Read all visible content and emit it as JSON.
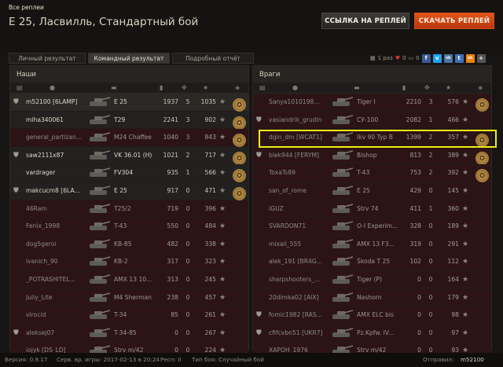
{
  "header": {
    "breadcrumb": "Все реплеи",
    "title": "E 25, Ласвилль, Стандартный бой",
    "link_button": "ССЫЛКА НА РЕПЛЕЙ",
    "download_button": "СКАЧАТЬ РЕПЛЕЙ"
  },
  "tabs": [
    "Личный результат",
    "Командный результат",
    "Подробный отчёт"
  ],
  "toolbar": {
    "views": "1 раз",
    "likes": "0",
    "comments": "0",
    "social": [
      "f",
      "v",
      "vk",
      "t",
      "ok",
      "+"
    ]
  },
  "allies": {
    "title": "Наши",
    "players": [
      {
        "name": "m52100 [6LAMP]",
        "tank": "E 25",
        "damage": "1937",
        "kills": "5",
        "xp": "1035",
        "state": "me",
        "clan": true,
        "medal": true
      },
      {
        "name": "miha340061",
        "tank": "T29",
        "damage": "2241",
        "kills": "3",
        "xp": "902",
        "state": "alive",
        "clan": false,
        "medal": true
      },
      {
        "name": "general_partizan...",
        "tank": "M24 Chaffee",
        "damage": "1040",
        "kills": "3",
        "xp": "843",
        "state": "dead",
        "clan": false,
        "medal": true
      },
      {
        "name": "saw2111x87",
        "tank": "VK 36.01 (H)",
        "damage": "1021",
        "kills": "2",
        "xp": "717",
        "state": "alive",
        "clan": true,
        "medal": true
      },
      {
        "name": "vardrager",
        "tank": "FV304",
        "damage": "935",
        "kills": "1",
        "xp": "566",
        "state": "alive",
        "clan": false,
        "medal": true
      },
      {
        "name": "makcucm8 [6LA...",
        "tank": "E 25",
        "damage": "917",
        "kills": "0",
        "xp": "471",
        "state": "alive",
        "clan": true,
        "medal": true
      },
      {
        "name": "46Ram",
        "tank": "T25/2",
        "damage": "719",
        "kills": "0",
        "xp": "396",
        "state": "dead",
        "clan": false,
        "medal": false
      },
      {
        "name": "Fenix_1998",
        "tank": "T-43",
        "damage": "550",
        "kills": "0",
        "xp": "484",
        "state": "dead",
        "clan": false,
        "medal": false
      },
      {
        "name": "dog5geroi",
        "tank": "KB-85",
        "damage": "482",
        "kills": "0",
        "xp": "338",
        "state": "dead",
        "clan": false,
        "medal": false
      },
      {
        "name": "ivanich_90",
        "tank": "KB-2",
        "damage": "317",
        "kills": "0",
        "xp": "323",
        "state": "dead",
        "clan": false,
        "medal": false
      },
      {
        "name": "_POTRASHITEL...",
        "tank": "AMX 13 10...",
        "damage": "313",
        "kills": "0",
        "xp": "245",
        "state": "dead",
        "clan": false,
        "medal": false
      },
      {
        "name": "Juliy_Lite",
        "tank": "M4 Sherman",
        "damage": "238",
        "kills": "0",
        "xp": "457",
        "state": "dead",
        "clan": false,
        "medal": false
      },
      {
        "name": "virocid",
        "tank": "T-34",
        "damage": "85",
        "kills": "0",
        "xp": "261",
        "state": "dead",
        "clan": false,
        "medal": false
      },
      {
        "name": "aleksej07",
        "tank": "T-34-85",
        "damage": "0",
        "kills": "0",
        "xp": "267",
        "state": "dead",
        "clan": true,
        "medal": false
      },
      {
        "name": "iojyk [DS_LD]",
        "tank": "Strv m/42",
        "damage": "0",
        "kills": "0",
        "xp": "224",
        "state": "dead",
        "clan": false,
        "medal": false
      }
    ]
  },
  "enemies": {
    "title": "Враги",
    "players": [
      {
        "name": "Sanya1010198...",
        "tank": "Tiger I",
        "damage": "2210",
        "kills": "3",
        "xp": "576",
        "state": "dead",
        "clan": false,
        "medal": true
      },
      {
        "name": "vasiandrik_grudin",
        "tank": "СУ-100",
        "damage": "2082",
        "kills": "1",
        "xp": "466",
        "state": "dead",
        "clan": true,
        "medal": false
      },
      {
        "name": "dgin_dm [WCAT1]",
        "tank": "Ikv 90 Typ B",
        "damage": "1399",
        "kills": "2",
        "xp": "357",
        "state": "dead",
        "clan": false,
        "medal": true
      },
      {
        "name": "blek944 [FERYM]",
        "tank": "Bishop",
        "damage": "813",
        "kills": "2",
        "xp": "389",
        "state": "dead",
        "clan": true,
        "medal": true
      },
      {
        "name": "ToxaTs89",
        "tank": "T-43",
        "damage": "753",
        "kills": "2",
        "xp": "392",
        "state": "dead",
        "clan": false,
        "medal": true
      },
      {
        "name": "san_of_rome",
        "tank": "E 25",
        "damage": "429",
        "kills": "0",
        "xp": "145",
        "state": "dead",
        "clan": false,
        "medal": false
      },
      {
        "name": "IGUZ",
        "tank": "Strv 74",
        "damage": "411",
        "kills": "1",
        "xp": "360",
        "state": "dead",
        "clan": false,
        "medal": false
      },
      {
        "name": "SVARDON71",
        "tank": "O-I Experim...",
        "damage": "328",
        "kills": "0",
        "xp": "189",
        "state": "dead",
        "clan": false,
        "medal": false
      },
      {
        "name": "mixail_555",
        "tank": "AMX 13 F3...",
        "damage": "319",
        "kills": "0",
        "xp": "291",
        "state": "dead",
        "clan": false,
        "medal": false
      },
      {
        "name": "alek_191 [BR4G...",
        "tank": "Škoda T 25",
        "damage": "102",
        "kills": "0",
        "xp": "112",
        "state": "dead",
        "clan": false,
        "medal": false
      },
      {
        "name": "sharpshooters_...",
        "tank": "Tiger (P)",
        "damage": "0",
        "kills": "0",
        "xp": "164",
        "state": "dead",
        "clan": false,
        "medal": false
      },
      {
        "name": "20dimka02 [AIX]",
        "tank": "Nashorn",
        "damage": "0",
        "kills": "0",
        "xp": "179",
        "state": "dead",
        "clan": false,
        "medal": false
      },
      {
        "name": "fomic1982 [RAS...",
        "tank": "AMX ELC bis",
        "damage": "0",
        "kills": "0",
        "xp": "98",
        "state": "dead",
        "clan": true,
        "medal": false
      },
      {
        "name": "cfifcvbn51 [UKR7]",
        "tank": "Pz.Kpfw. IV...",
        "damage": "0",
        "kills": "0",
        "xp": "97",
        "state": "dead",
        "clan": true,
        "medal": false
      },
      {
        "name": "XAPOH_1976",
        "tank": "Strv m/42",
        "damage": "0",
        "kills": "0",
        "xp": "93",
        "state": "dead",
        "clan": false,
        "medal": false
      }
    ]
  },
  "footer": {
    "version": "Версия: 0.9.17",
    "server_time": "Серв. вр. игры: 2017-02-13 в 20:24",
    "respawn": "Респ: II",
    "battle_type": "Тип боя: Случайный бой",
    "sender_label": "Отправил:",
    "sender": "m52100"
  },
  "colors": {
    "accent": "#d34a14",
    "highlight": "#f1ee16",
    "dead_row": "#2c1416",
    "alive_row": "#222120"
  }
}
